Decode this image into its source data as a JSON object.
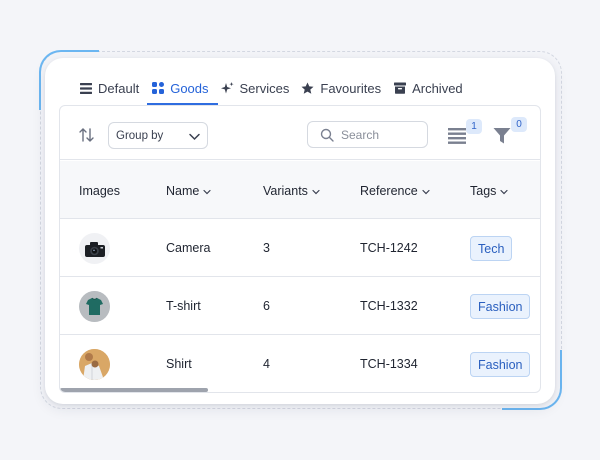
{
  "tabs": [
    {
      "label": "Default",
      "icon": "list-icon",
      "active": false
    },
    {
      "label": "Goods",
      "icon": "grid-icon",
      "active": true
    },
    {
      "label": "Services",
      "icon": "sparkle-icon",
      "active": false
    },
    {
      "label": "Favourites",
      "icon": "star-icon",
      "active": false
    },
    {
      "label": "Archived",
      "icon": "archive-icon",
      "active": false
    }
  ],
  "toolbar": {
    "group_by_label": "Group by",
    "search_placeholder": "Search",
    "columns_badge": "1",
    "filter_badge": "0"
  },
  "table": {
    "columns": [
      "Images",
      "Name",
      "Variants",
      "Reference",
      "Tags"
    ],
    "rows": [
      {
        "image": "camera",
        "name": "Camera",
        "variants": "3",
        "reference": "TCH-1242",
        "tag": "Tech"
      },
      {
        "image": "tshirt",
        "name": "T-shirt",
        "variants": "6",
        "reference": "TCH-1332",
        "tag": "Fashion"
      },
      {
        "image": "shirt",
        "name": "Shirt",
        "variants": "4",
        "reference": "TCH-1334",
        "tag": "Fashion"
      }
    ]
  },
  "colors": {
    "accent": "#2563d9",
    "tag_bg": "#eaf2fd",
    "tag_border": "#bcd4f3",
    "badge_bg": "#dde9fb"
  }
}
